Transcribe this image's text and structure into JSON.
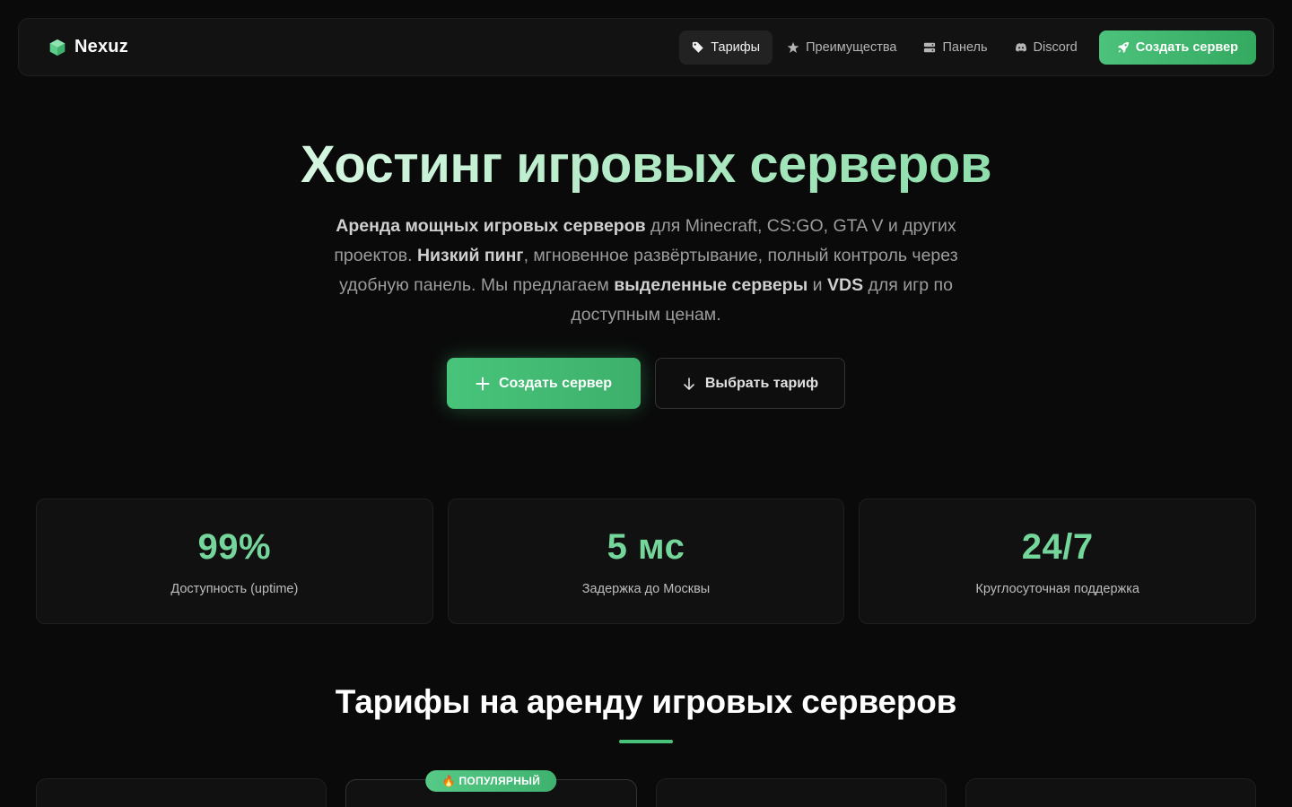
{
  "brand": {
    "name": "Nexuz",
    "icon": "cube-icon"
  },
  "nav": {
    "items": [
      {
        "label": "Тарифы",
        "icon": "tag-icon",
        "active": true
      },
      {
        "label": "Преимущества",
        "icon": "star-icon",
        "active": false
      },
      {
        "label": "Панель",
        "icon": "server-icon",
        "active": false
      },
      {
        "label": "Discord",
        "icon": "discord-icon",
        "active": false
      }
    ],
    "cta_label": "Создать сервер",
    "cta_icon": "rocket-icon"
  },
  "hero": {
    "title": "Хостинг игровых серверов",
    "description": {
      "p1_bold": "Аренда мощных игровых серверов",
      "p2": " для Minecraft, CS:GO, GTA V и других проектов. ",
      "p3_bold": "Низкий пинг",
      "p4": ", мгновенное развёртывание, полный контроль через удобную панель. Мы предлагаем ",
      "p5_bold": "выделенные серверы",
      "p6": " и ",
      "p7_bold": "VDS",
      "p8": " для игр по доступным ценам."
    },
    "primary_button": "Создать сервер",
    "secondary_button": "Выбрать тариф"
  },
  "stats": [
    {
      "value": "99%",
      "label": "Доступность (uptime)"
    },
    {
      "value": "5 мс",
      "label": "Задержка до Москвы"
    },
    {
      "value": "24/7",
      "label": "Круглосуточная поддержка"
    }
  ],
  "pricing": {
    "title": "Тарифы на аренду игровых серверов",
    "popular_badge": "🔥 ПОПУЛЯРНЫЙ"
  },
  "colors": {
    "accent": "#48c47a",
    "background": "#0a0a0a",
    "card": "#111111"
  }
}
